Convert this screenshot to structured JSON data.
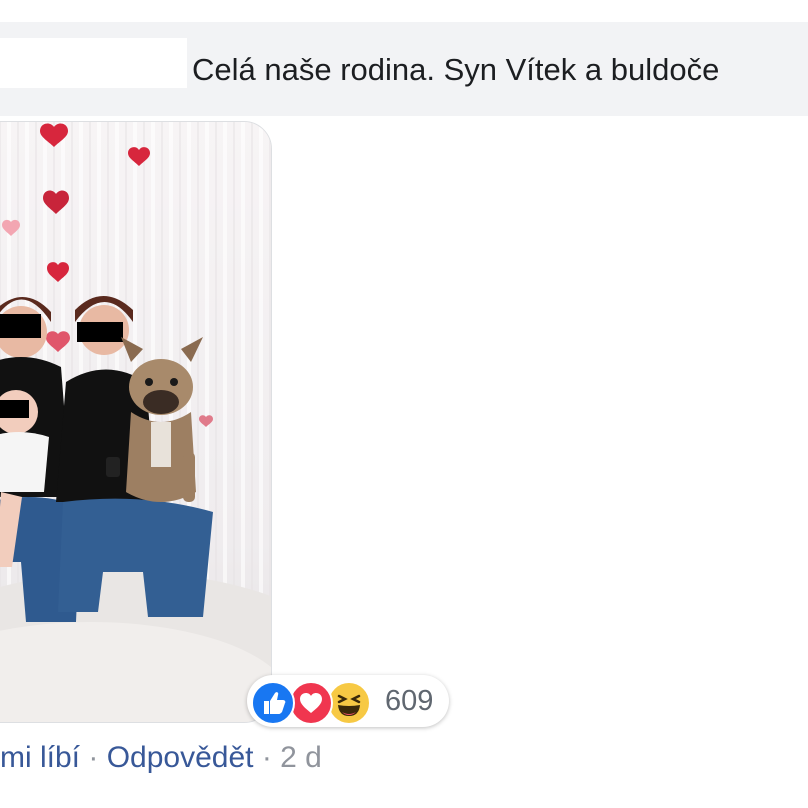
{
  "comment": {
    "text": "Celá naše rodina. Syn Vítek a buldoče"
  },
  "reactions": {
    "icons": [
      "like-icon",
      "love-icon",
      "haha-icon"
    ],
    "count": "609",
    "colors": {
      "like": "#1877f2",
      "love": "#f0364f",
      "haha": "#f7c944"
    }
  },
  "actions": {
    "like_label": "mi líbí",
    "separator": "·",
    "reply_label": "Odpovědět",
    "timestamp": "2 d"
  },
  "colors": {
    "link": "#385898",
    "muted": "#90949c",
    "bubble": "#f2f3f5"
  }
}
